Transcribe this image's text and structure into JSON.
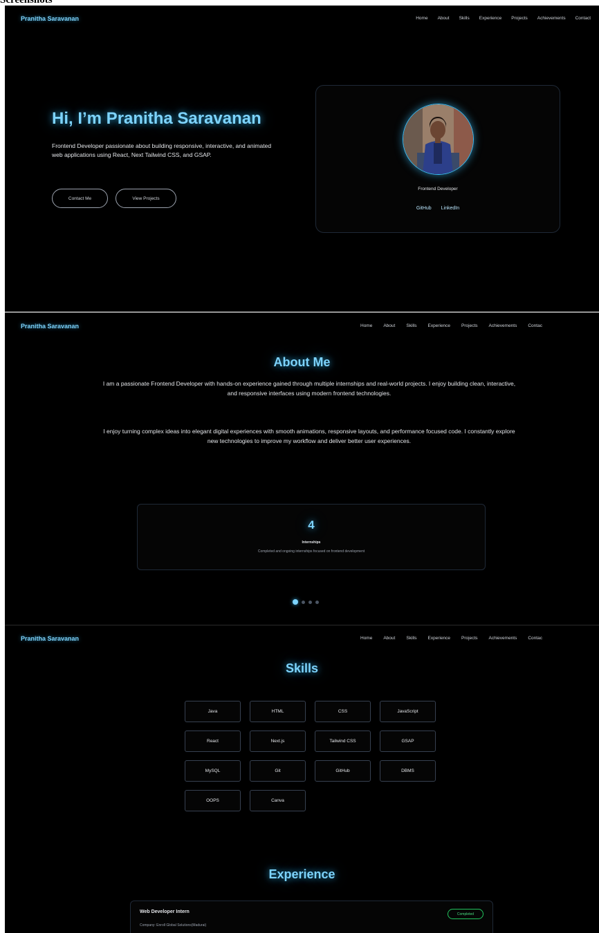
{
  "caption": "Screenshots",
  "brand": "Pranitha Saravanan",
  "nav": [
    "Home",
    "About",
    "Skills",
    "Experience",
    "Projects",
    "Achievements",
    "Contact"
  ],
  "nav_cut": [
    "Home",
    "About",
    "Skills",
    "Experience",
    "Projects",
    "Achievements",
    "Contac"
  ],
  "hero": {
    "title": "Hi, I’m Pranitha Saravanan",
    "description": "Frontend Developer passionate about building responsive, interactive, and animated web applications using React, Next Tailwind CSS, and GSAP.",
    "contact_button": "Contact Me",
    "projects_button": "View Projects",
    "role": "Frontend Developer",
    "github": "GitHub",
    "linkedin": "LinkedIn"
  },
  "about": {
    "title": "About Me",
    "p1": "I am a passionate Frontend Developer with hands-on experience gained through multiple internships and real-world projects. I enjoy building clean, interactive, and responsive interfaces using modern frontend technologies.",
    "p2": "I enjoy turning complex ideas into elegant digital experiences with smooth animations, responsive layouts, and performance focused code. I constantly explore new technologies to improve my workflow and deliver better user experiences.",
    "stat_number": "4",
    "stat_label": "Internships",
    "stat_desc": "Completed and ongoing internships focused on frontend development",
    "carousel": {
      "total": 4,
      "active": 1
    }
  },
  "skills": {
    "title": "Skills",
    "items": [
      "Java",
      "HTML",
      "CSS",
      "JavaScript",
      "React",
      "Next.js",
      "Tailwind CSS",
      "GSAP",
      "MySQL",
      "Git",
      "GitHub",
      "DBMS",
      "OOPS",
      "Canva"
    ]
  },
  "experience": {
    "title": "Experience",
    "role": "Web Developer Intern",
    "company": "Company: Enroll Global Solutions(Madurai)",
    "status": "Completed"
  },
  "colors": {
    "accent": "#7dd3fc",
    "background": "#000000",
    "badge": "#22c55e"
  }
}
